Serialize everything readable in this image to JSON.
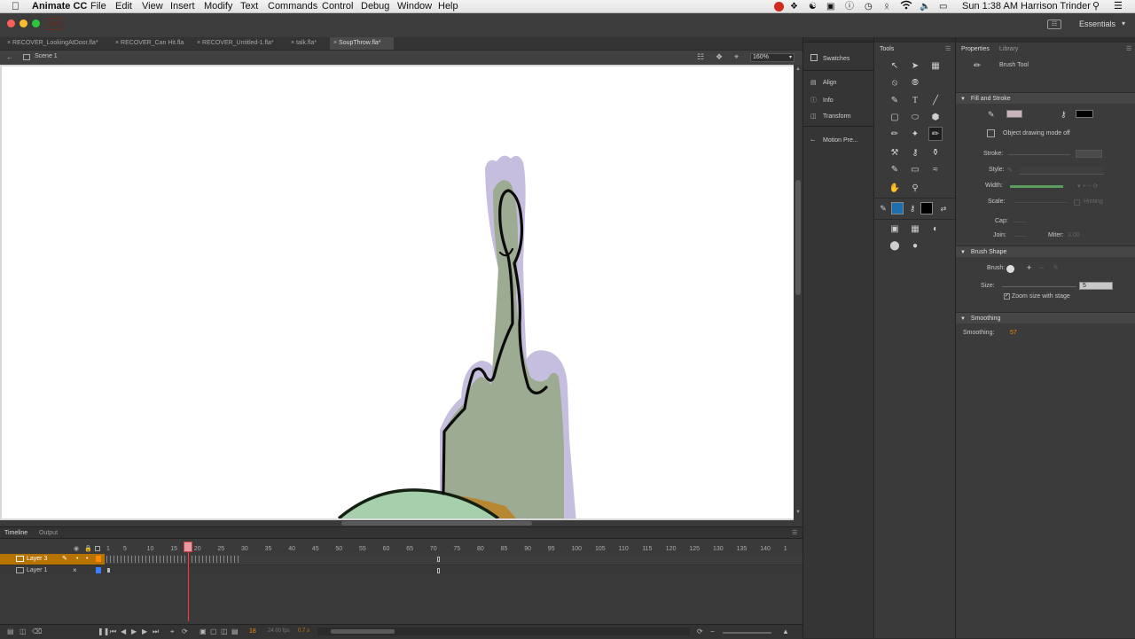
{
  "menubar": {
    "app_name": "Animate CC",
    "items": [
      "File",
      "Edit",
      "View",
      "Insert",
      "Modify",
      "Text",
      "Commands",
      "Control",
      "Debug",
      "Window",
      "Help"
    ],
    "clock": "Sun 1:38 AM",
    "user": "Harrison Trinder"
  },
  "appbar": {
    "app_badge": "An",
    "workspace": "Essentials"
  },
  "document_tabs": [
    {
      "label": "RECOVER_LookingAtDoor.fla*"
    },
    {
      "label": "RECOVER_Can Hit.fla"
    },
    {
      "label": "RECOVER_Untitled-1.fla*"
    },
    {
      "label": "talk.fla*"
    },
    {
      "label": "SoupThrow.fla*"
    }
  ],
  "scene": {
    "label": "Scene 1",
    "zoom": "160%"
  },
  "timeline": {
    "tabs": [
      "Timeline",
      "Output"
    ],
    "frame_labels": [
      "1",
      "5",
      "10",
      "15",
      "20",
      "25",
      "30",
      "35",
      "40",
      "45",
      "50",
      "55",
      "60",
      "65",
      "70",
      "75",
      "80",
      "85",
      "90",
      "95",
      "100",
      "105",
      "110",
      "115",
      "120",
      "125",
      "130",
      "135",
      "140",
      "1"
    ],
    "layers": [
      {
        "name": "Layer 3",
        "selected": true,
        "color": "#ff8a00"
      },
      {
        "name": "Layer 1",
        "selected": false,
        "color": "#3a7dff"
      }
    ],
    "current_frame": "18",
    "fps": "24.00 fps",
    "time": "0.7 s"
  },
  "panel_group": {
    "items": [
      "Swatches",
      "Align",
      "Info",
      "Transform",
      "Motion Pre..."
    ]
  },
  "tools_panel": {
    "title": "Tools"
  },
  "properties": {
    "tabs": [
      "Properties",
      "Library"
    ],
    "tool_name": "Brush Tool",
    "fill_stroke_title": "Fill and Stroke",
    "object_drawing": "Object drawing mode off",
    "stroke_label": "Stroke:",
    "style_label": "Style:",
    "width_label": "Width:",
    "scale_label": "Scale:",
    "hinting_label": "Hinting",
    "cap_label": "Cap:",
    "join_label": "Join:",
    "miter_label": "Miter:",
    "miter_value": "3.00",
    "brush_shape_title": "Brush Shape",
    "brush_label": "Brush:",
    "size_label": "Size:",
    "size_value": "5",
    "zoom_size": "Zoom size with stage",
    "smoothing_title": "Smoothing",
    "smoothing_label": "Smoothing:",
    "smoothing_value": "57",
    "fill_color": "#c8b4ba",
    "stroke_color": "#000000"
  },
  "colors": {
    "accent": "#ff8a00",
    "playhead": "#ff3a3a",
    "selected_tool": "#1e6fb0"
  }
}
